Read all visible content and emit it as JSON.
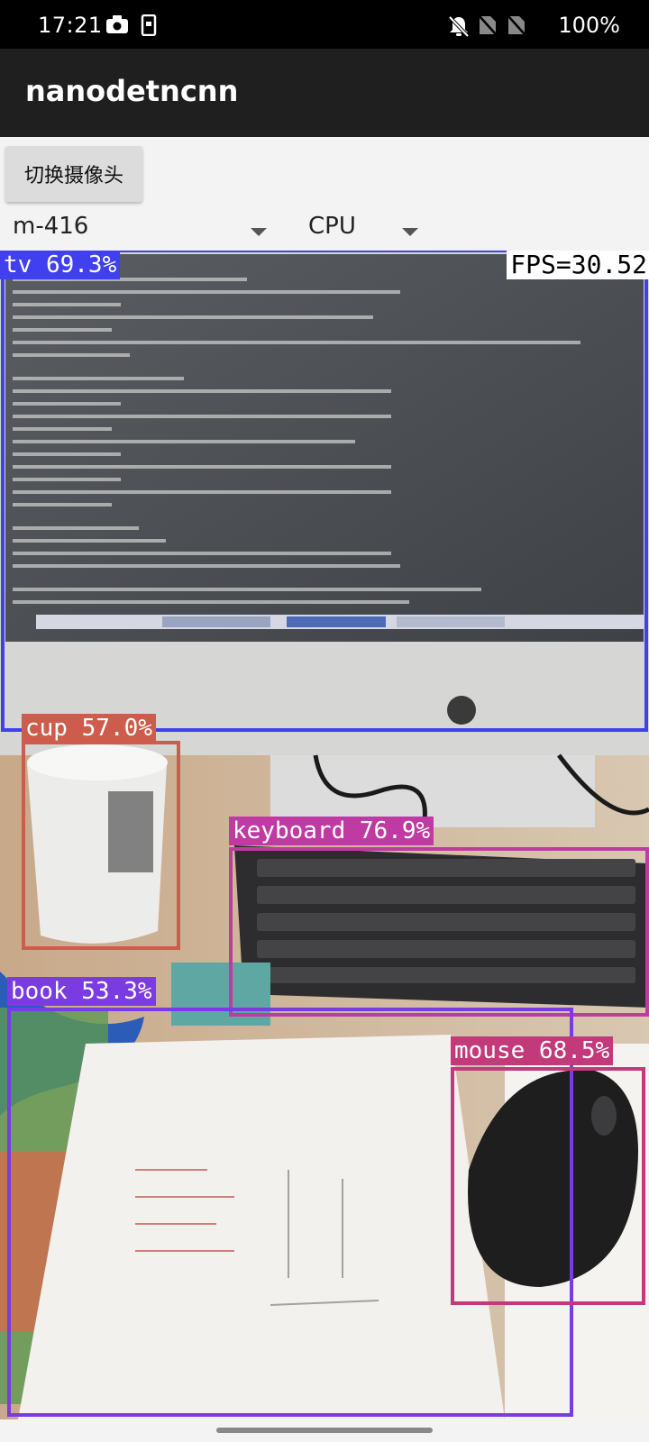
{
  "status_bar": {
    "time": "17:21",
    "battery": "100%"
  },
  "app": {
    "title": "nanodetncnn"
  },
  "controls": {
    "switch_camera_label": "切换摄像头",
    "model_selected": "m-416",
    "device_selected": "CPU"
  },
  "overlay": {
    "fps": "FPS=30.52"
  },
  "detections": [
    {
      "label": "tv 69.3%",
      "color": "#4040ee"
    },
    {
      "label": "cup 57.0%",
      "color": "#cd5c4c"
    },
    {
      "label": "keyboard 76.9%",
      "color": "#c03aa3"
    },
    {
      "label": "book 53.3%",
      "color": "#7b3be3"
    },
    {
      "label": "mouse 68.5%",
      "color": "#c23a7a"
    }
  ],
  "icons": {
    "camera": "camera-icon",
    "screenshot": "screenshot-icon",
    "silent": "bell-off-icon",
    "sim": "no-sim-icon"
  }
}
